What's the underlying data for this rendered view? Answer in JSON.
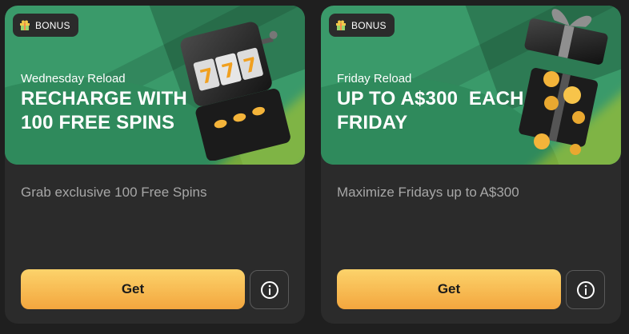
{
  "cards": [
    {
      "badge": "BONUS",
      "subtitle": "Wednesday Reload",
      "title_line1": "RECHARGE WITH",
      "title_line2": "100 FREE SPINS",
      "description": "Grab exclusive 100 Free Spins",
      "button": "Get",
      "art_icon": "slot-machine-icon"
    },
    {
      "badge": "BONUS",
      "subtitle": "Friday Reload",
      "title_line1": "UP TO A$300  EACH",
      "title_line2": "FRIDAY",
      "description": "Maximize Fridays up to A$300",
      "button": "Get",
      "art_icon": "gift-box-coins-icon"
    }
  ],
  "colors": {
    "background": "#1f1f1f",
    "card": "#2b2b2b",
    "banner_green": "#3a9a6a",
    "button_top": "#fcd36b",
    "button_bottom": "#f3a63e"
  }
}
